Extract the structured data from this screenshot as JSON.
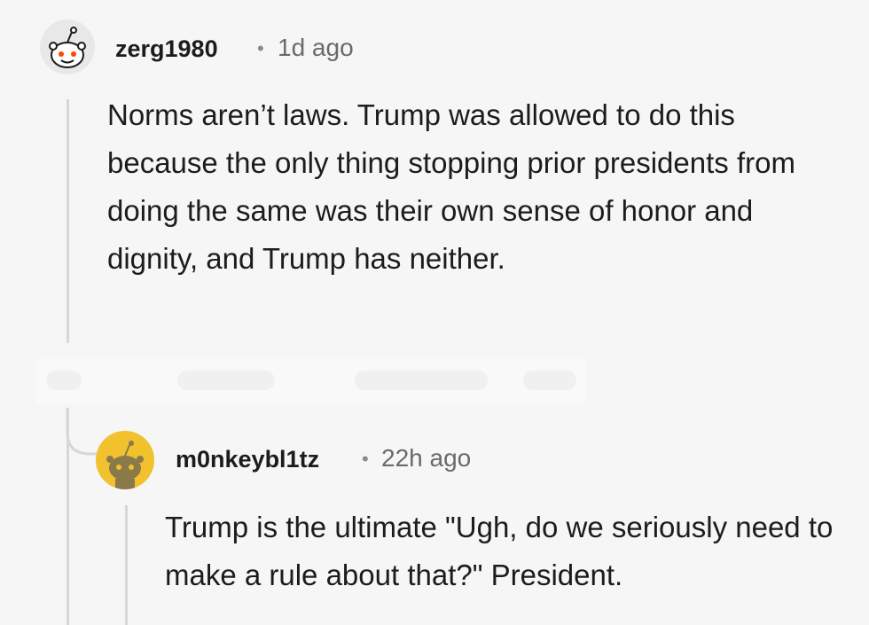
{
  "comments": [
    {
      "username": "zerg1980",
      "separator": "•",
      "time": "1d ago",
      "body": "Norms aren’t laws. Trump was allowed to do this because the only thing stopping prior presidents from doing the same was their own sense of honor and dignity, and Trump has neither.",
      "avatar_icon": "snoo-avatar-icon",
      "avatar_bg": "#e8e8e8"
    },
    {
      "username": "m0nkeybl1tz",
      "separator": "•",
      "time": "22h ago",
      "body": "Trump is the ultimate \"Ugh, do we seriously need to make a rule about that?\" President.",
      "avatar_icon": "snoo-avatar-icon",
      "avatar_bg": "#f2c12e"
    }
  ]
}
